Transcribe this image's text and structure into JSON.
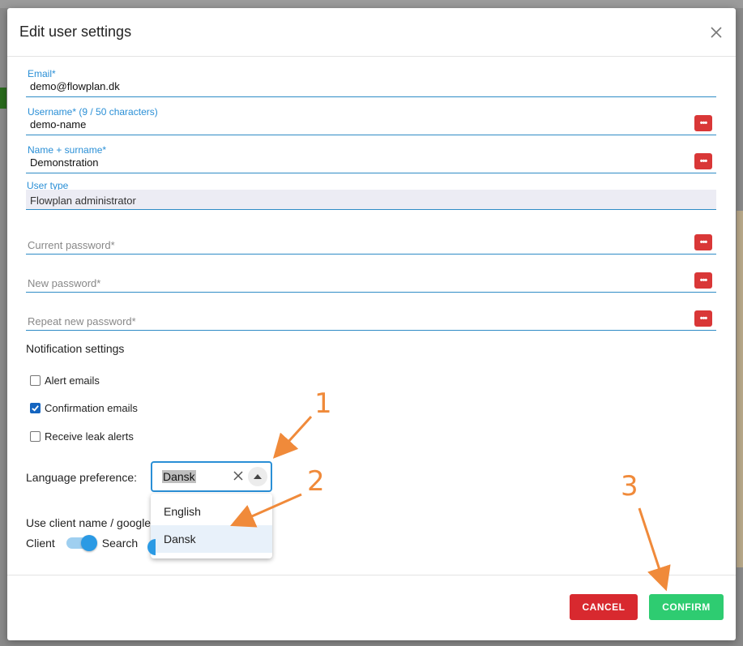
{
  "modal": {
    "title": "Edit user settings"
  },
  "fields": {
    "email": {
      "label": "Email*",
      "value": "demo@flowplan.dk"
    },
    "username": {
      "label": "Username* (9 / 50 characters)",
      "value": "demo-name"
    },
    "name": {
      "label": "Name + surname*",
      "value": "Demonstration"
    },
    "user_type": {
      "label": "User type",
      "value": "Flowplan administrator"
    },
    "current_password": {
      "placeholder": "Current password*"
    },
    "new_password": {
      "placeholder": "New password*"
    },
    "repeat_password": {
      "placeholder": "Repeat new password*"
    }
  },
  "notifications": {
    "title": "Notification settings",
    "items": [
      {
        "label": "Alert emails",
        "checked": false
      },
      {
        "label": "Confirmation emails",
        "checked": true
      },
      {
        "label": "Receive leak alerts",
        "checked": false
      }
    ]
  },
  "language": {
    "label": "Language preference:",
    "selected": "Dansk",
    "options": [
      {
        "label": "English",
        "selected": false
      },
      {
        "label": "Dansk",
        "selected": true
      }
    ]
  },
  "client_search": {
    "text": "Use client name / google",
    "left_label": "Client",
    "right_label": "Search"
  },
  "footer": {
    "cancel": "CANCEL",
    "confirm": "CONFIRM"
  },
  "annotations": {
    "one": "1",
    "two": "2",
    "three": "3"
  },
  "colors": {
    "accent": "#2a8fd6",
    "danger": "#d8292f",
    "success": "#2ecc71",
    "annotation": "#f08a3a"
  }
}
